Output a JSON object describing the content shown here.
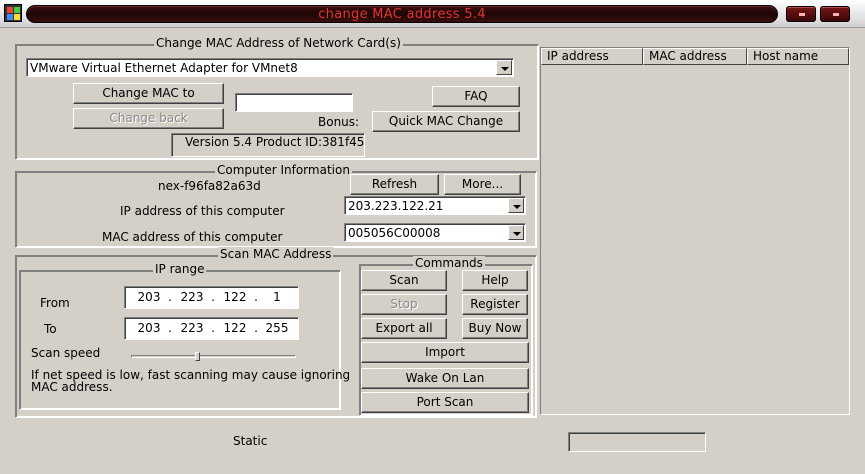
{
  "window": {
    "title": "change MAC address 5.4"
  },
  "change_mac": {
    "caption": "Change MAC  Address of Network Card(s)",
    "adapter_selected": "VMware Virtual Ethernet Adapter for VMnet8",
    "change_mac_label": "Change MAC to",
    "change_back_label": "Change back",
    "new_mac_value": "",
    "faq_label": "FAQ",
    "bonus_label": "Bonus:",
    "quick_mac_label": "Quick MAC Change",
    "version_text": "Version 5.4  Product ID:381f45"
  },
  "computer_info": {
    "caption": "Computer Information",
    "host_name": "nex-f96fa82a63d",
    "refresh_label": "Refresh",
    "more_label": "More...",
    "ip_label": "IP address of this computer",
    "ip_selected": "203.223.122.21",
    "mac_label": "MAC address of this computer",
    "mac_selected": "005056C00008"
  },
  "scan": {
    "caption": "Scan MAC Address",
    "ip_range_caption": "IP range",
    "from_label": "From",
    "from_ip": [
      "203",
      "223",
      "122",
      "1"
    ],
    "to_label": "To",
    "to_ip": [
      "203",
      "223",
      "122",
      "255"
    ],
    "scan_speed_label": "Scan speed",
    "scan_speed_fraction": 0.4,
    "warning_line1": "If net speed is low,  fast scanning may cause ignoring",
    "warning_line2": "MAC address."
  },
  "commands": {
    "caption": "Commands",
    "scan_label": "Scan",
    "help_label": "Help",
    "stop_label": "Stop",
    "register_label": "Register",
    "export_all_label": "Export all",
    "buy_now_label": "Buy Now",
    "import_label": "Import",
    "wake_on_lan_label": "Wake On Lan",
    "port_scan_label": "Port Scan"
  },
  "results": {
    "columns": [
      "IP address",
      "MAC address",
      "Host name"
    ]
  },
  "status": {
    "static_label": "Static",
    "status_value": ""
  },
  "colors": {
    "title_text": "#e23434",
    "dialog_bg": "#d4d0c8"
  }
}
